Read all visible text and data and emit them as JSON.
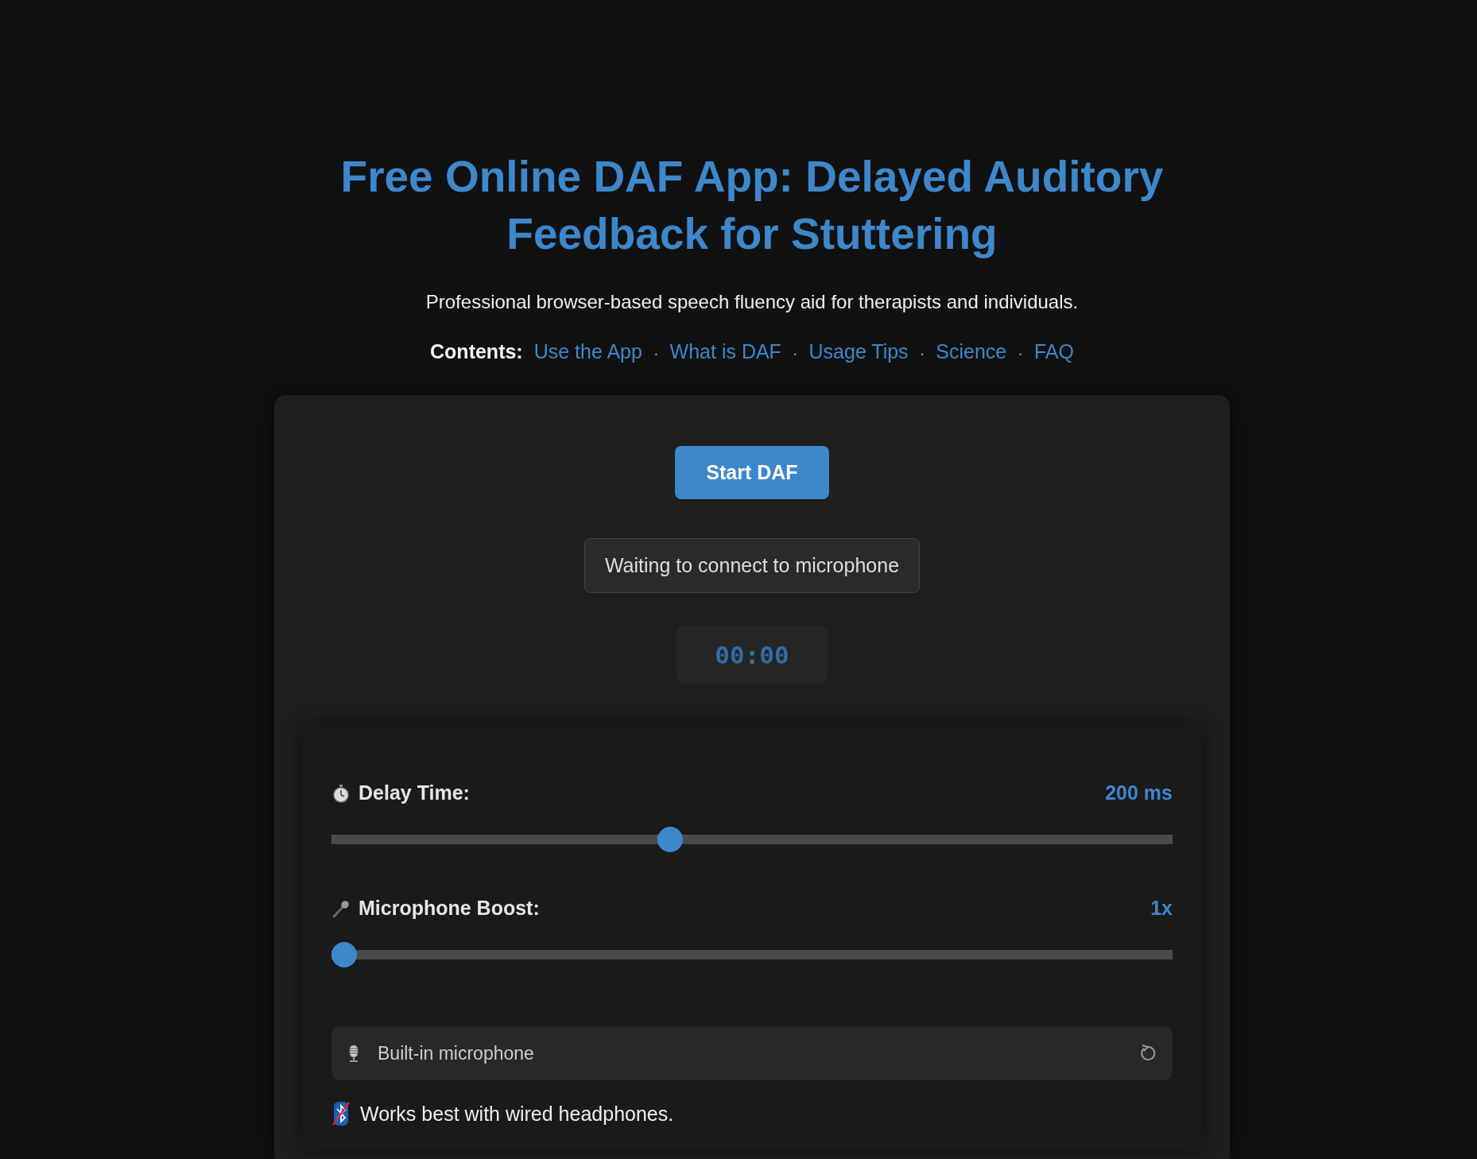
{
  "title": "Free Online DAF App: Delayed Auditory Feedback for Stuttering",
  "subtitle": "Professional browser-based speech fluency aid for therapists and individuals.",
  "contents": {
    "label": "Contents:",
    "links": [
      "Use the App",
      "What is DAF",
      "Usage Tips",
      "Science",
      "FAQ"
    ],
    "separator": "·"
  },
  "start_button": "Start DAF",
  "status": "Waiting to connect to microphone",
  "timer": "00:00",
  "sliders": [
    {
      "kind": "delay",
      "label": "Delay Time:",
      "reading": "200 ms",
      "level": 0.4
    },
    {
      "kind": "boost",
      "label": "Microphone Boost:",
      "reading": "1x",
      "level": 0
    }
  ],
  "device": {
    "name": "Built-in microphone"
  },
  "note": "Works best with wired headphones."
}
